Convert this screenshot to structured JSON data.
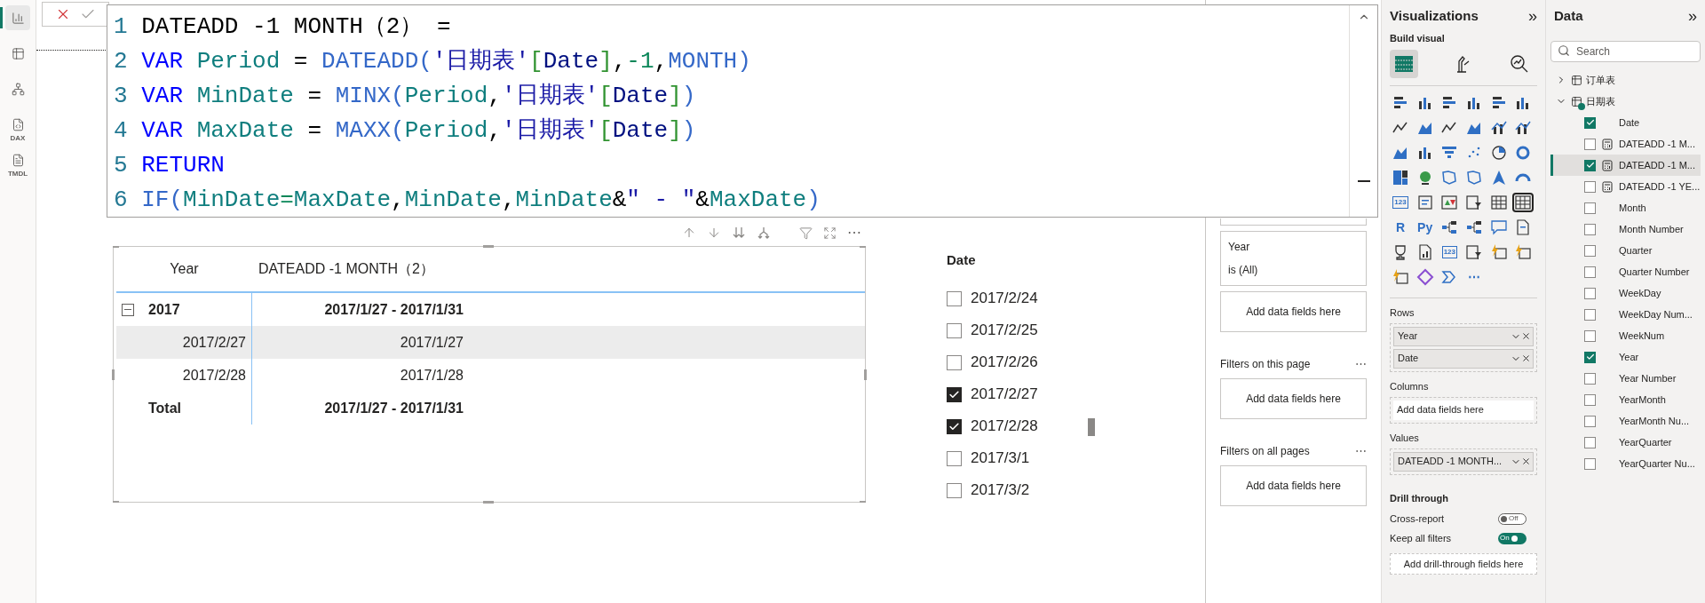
{
  "left_rail": [
    {
      "selected": true
    },
    {
      "selected": false
    },
    {
      "selected": false
    },
    {
      "selected": false,
      "badge": "DAX"
    },
    {
      "selected": false,
      "badge": "TMDL"
    }
  ],
  "formula": {
    "lines": [
      {
        "number": "1",
        "tokens": [
          {
            "text": "DATEADD -1 MONTH（2） =",
            "kind": "plain"
          }
        ]
      },
      {
        "number": "2",
        "tokens": [
          {
            "text": "VAR",
            "kind": "keyword"
          },
          {
            "text": " Period",
            "kind": "variable"
          },
          {
            "text": " = ",
            "kind": "plain"
          },
          {
            "text": "DATEADD(",
            "kind": "function"
          },
          {
            "text": "'日期表'",
            "kind": "table"
          },
          {
            "text": "[",
            "kind": "bracket"
          },
          {
            "text": "Date",
            "kind": "column"
          },
          {
            "text": "]",
            "kind": "bracket"
          },
          {
            "text": ",",
            "kind": "plain"
          },
          {
            "text": "-1",
            "kind": "number"
          },
          {
            "text": ",",
            "kind": "plain"
          },
          {
            "text": "MONTH)",
            "kind": "function"
          }
        ]
      },
      {
        "number": "3",
        "tokens": [
          {
            "text": "VAR",
            "kind": "keyword"
          },
          {
            "text": " MinDate",
            "kind": "variable"
          },
          {
            "text": " = ",
            "kind": "plain"
          },
          {
            "text": "MINX(",
            "kind": "function"
          },
          {
            "text": "Period",
            "kind": "variable"
          },
          {
            "text": ",",
            "kind": "plain"
          },
          {
            "text": "'日期表'",
            "kind": "table"
          },
          {
            "text": "[",
            "kind": "bracket"
          },
          {
            "text": "Date",
            "kind": "column"
          },
          {
            "text": "]",
            "kind": "bracket"
          },
          {
            "text": ")",
            "kind": "function"
          }
        ]
      },
      {
        "number": "4",
        "tokens": [
          {
            "text": "VAR",
            "kind": "keyword"
          },
          {
            "text": " MaxDate",
            "kind": "variable"
          },
          {
            "text": " = ",
            "kind": "plain"
          },
          {
            "text": "MAXX(",
            "kind": "function"
          },
          {
            "text": "Period",
            "kind": "variable"
          },
          {
            "text": ",",
            "kind": "plain"
          },
          {
            "text": "'日期表'",
            "kind": "table"
          },
          {
            "text": "[",
            "kind": "bracket"
          },
          {
            "text": "Date",
            "kind": "column"
          },
          {
            "text": "]",
            "kind": "bracket"
          },
          {
            "text": ")",
            "kind": "function"
          }
        ]
      },
      {
        "number": "5",
        "tokens": [
          {
            "text": "RETURN",
            "kind": "keyword"
          }
        ]
      },
      {
        "number": "6",
        "tokens": [
          {
            "text": "IF(",
            "kind": "function"
          },
          {
            "text": "MinDate",
            "kind": "variable"
          },
          {
            "text": "=",
            "kind": "operator"
          },
          {
            "text": "MaxDate",
            "kind": "variable"
          },
          {
            "text": ",",
            "kind": "plain"
          },
          {
            "text": "MinDate",
            "kind": "variable"
          },
          {
            "text": ",",
            "kind": "plain"
          },
          {
            "text": "MinDate",
            "kind": "variable"
          },
          {
            "text": "&",
            "kind": "plain"
          },
          {
            "text": "\" - \"",
            "kind": "string"
          },
          {
            "text": "&",
            "kind": "plain"
          },
          {
            "text": "MaxDate",
            "kind": "variable"
          },
          {
            "text": ")",
            "kind": "function"
          }
        ]
      }
    ]
  },
  "table_visual": {
    "columns": [
      "Year",
      "DATEADD -1 MONTH（2）"
    ],
    "rows": [
      {
        "kind": "group",
        "expanded": true,
        "highlighted": false,
        "cells": [
          "2017",
          "2017/1/27 - 2017/1/31"
        ]
      },
      {
        "kind": "detail",
        "highlighted": true,
        "cells": [
          "2017/2/27",
          "2017/1/27"
        ]
      },
      {
        "kind": "detail",
        "highlighted": false,
        "cells": [
          "2017/2/28",
          "2017/1/28"
        ]
      },
      {
        "kind": "total",
        "highlighted": false,
        "cells": [
          "Total",
          "2017/1/27 - 2017/1/31"
        ]
      }
    ],
    "more_glyph": "⋯"
  },
  "slicer": {
    "title": "Date",
    "items": [
      {
        "label": "2017/2/24",
        "checked": false
      },
      {
        "label": "2017/2/25",
        "checked": false
      },
      {
        "label": "2017/2/26",
        "checked": false
      },
      {
        "label": "2017/2/27",
        "checked": true
      },
      {
        "label": "2017/2/28",
        "checked": true
      },
      {
        "label": "2017/3/1",
        "checked": false
      },
      {
        "label": "2017/3/2",
        "checked": false
      }
    ]
  },
  "filters": {
    "visual_filters": [
      {
        "field": "Year",
        "condition": "is (All)"
      }
    ],
    "visual_add": "Add data fields here",
    "sections": [
      {
        "title": "Filters on this page",
        "more": "⋯",
        "add": "Add data fields here"
      },
      {
        "title": "Filters on all pages",
        "more": "⋯",
        "add": "Add data fields here"
      }
    ]
  },
  "visualizations": {
    "title": "Visualizations",
    "collapse": "»",
    "build_label": "Build visual",
    "modes": [
      {
        "selected": true
      },
      {
        "selected": false
      },
      {
        "selected": false
      }
    ],
    "visual_types": [
      {
        "selected": false
      },
      {
        "selected": false
      },
      {
        "selected": false
      },
      {
        "selected": false
      },
      {
        "selected": false
      },
      {
        "selected": false
      },
      {
        "selected": false
      },
      {
        "selected": false
      },
      {
        "selected": false
      },
      {
        "selected": false
      },
      {
        "selected": false
      },
      {
        "selected": false
      },
      {
        "selected": false
      },
      {
        "selected": false
      },
      {
        "selected": false
      },
      {
        "selected": false
      },
      {
        "selected": false
      },
      {
        "selected": false
      },
      {
        "selected": false
      },
      {
        "selected": false
      },
      {
        "selected": false
      },
      {
        "selected": false
      },
      {
        "selected": false
      },
      {
        "selected": false
      },
      {
        "selected": false,
        "glyph": "123"
      },
      {
        "selected": false
      },
      {
        "selected": false
      },
      {
        "selected": false
      },
      {
        "selected": false
      },
      {
        "selected": true
      },
      {
        "selected": false,
        "glyph": "R"
      },
      {
        "selected": false,
        "glyph": "Py"
      },
      {
        "selected": false
      },
      {
        "selected": false
      },
      {
        "selected": false
      },
      {
        "selected": false
      },
      {
        "selected": false
      },
      {
        "selected": false
      },
      {
        "selected": false,
        "glyph": "123"
      },
      {
        "selected": false
      },
      {
        "selected": false
      },
      {
        "selected": false
      },
      {
        "selected": false
      },
      {
        "selected": false
      },
      {
        "selected": false
      },
      {
        "selected": false,
        "glyph": "⋯"
      }
    ],
    "wells": [
      {
        "title": "Rows",
        "fields": [
          "Year",
          "Date"
        ]
      },
      {
        "title": "Columns",
        "placeholder": "Add data fields here"
      },
      {
        "title": "Values",
        "fields": [
          "DATEADD -1 MONTH..."
        ]
      }
    ],
    "drill": {
      "title": "Drill through",
      "toggles": [
        {
          "label": "Cross-report",
          "on": false,
          "text": "Off"
        },
        {
          "label": "Keep all filters",
          "on": true,
          "text": "On"
        }
      ],
      "add": "Add drill-through fields here"
    }
  },
  "data": {
    "title": "Data",
    "collapse": "»",
    "search": {
      "placeholder": "Search"
    },
    "tables": [
      {
        "name": "订单表",
        "expanded": false,
        "in_use": false
      },
      {
        "name": "日期表",
        "expanded": true,
        "in_use": true,
        "fields": [
          {
            "name": "Date",
            "kind": "column",
            "checked": true,
            "selected": false
          },
          {
            "name": "DATEADD -1 M...",
            "kind": "measure",
            "checked": false,
            "selected": false
          },
          {
            "name": "DATEADD -1 M...",
            "kind": "measure",
            "checked": true,
            "selected": true
          },
          {
            "name": "DATEADD -1 YE...",
            "kind": "measure",
            "checked": false,
            "selected": false
          },
          {
            "name": "Month",
            "kind": "column",
            "checked": false,
            "selected": false
          },
          {
            "name": "Month Number",
            "kind": "column",
            "checked": false,
            "selected": false
          },
          {
            "name": "Quarter",
            "kind": "column",
            "checked": false,
            "selected": false
          },
          {
            "name": "Quarter Number",
            "kind": "column",
            "checked": false,
            "selected": false
          },
          {
            "name": "WeekDay",
            "kind": "column",
            "checked": false,
            "selected": false
          },
          {
            "name": "WeekDay Num...",
            "kind": "column",
            "checked": false,
            "selected": false
          },
          {
            "name": "WeekNum",
            "kind": "column",
            "checked": false,
            "selected": false
          },
          {
            "name": "Year",
            "kind": "column",
            "checked": true,
            "selected": false
          },
          {
            "name": "Year Number",
            "kind": "column",
            "checked": false,
            "selected": false
          },
          {
            "name": "YearMonth",
            "kind": "column",
            "checked": false,
            "selected": false
          },
          {
            "name": "YearMonth Nu...",
            "kind": "column",
            "checked": false,
            "selected": false
          },
          {
            "name": "YearQuarter",
            "kind": "column",
            "checked": false,
            "selected": false
          },
          {
            "name": "YearQuarter Nu...",
            "kind": "column",
            "checked": false,
            "selected": false
          }
        ]
      }
    ]
  }
}
